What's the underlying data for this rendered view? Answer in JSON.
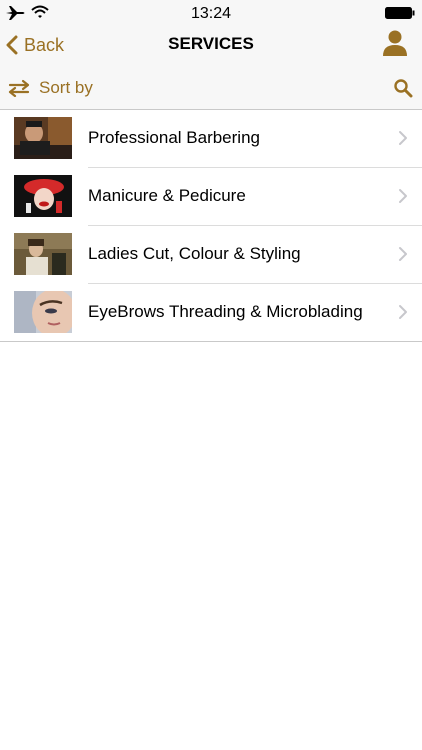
{
  "status_bar": {
    "time": "13:24"
  },
  "nav": {
    "back_label": "Back",
    "title": "SERVICES"
  },
  "toolbar": {
    "sort_label": "Sort by"
  },
  "colors": {
    "accent": "#9a7124",
    "bar_background": "#f7f7f7"
  },
  "services": [
    {
      "label": "Professional Barbering"
    },
    {
      "label": "Manicure & Pedicure"
    },
    {
      "label": "Ladies Cut, Colour & Styling"
    },
    {
      "label": "EyeBrows Threading & Microblading"
    }
  ]
}
